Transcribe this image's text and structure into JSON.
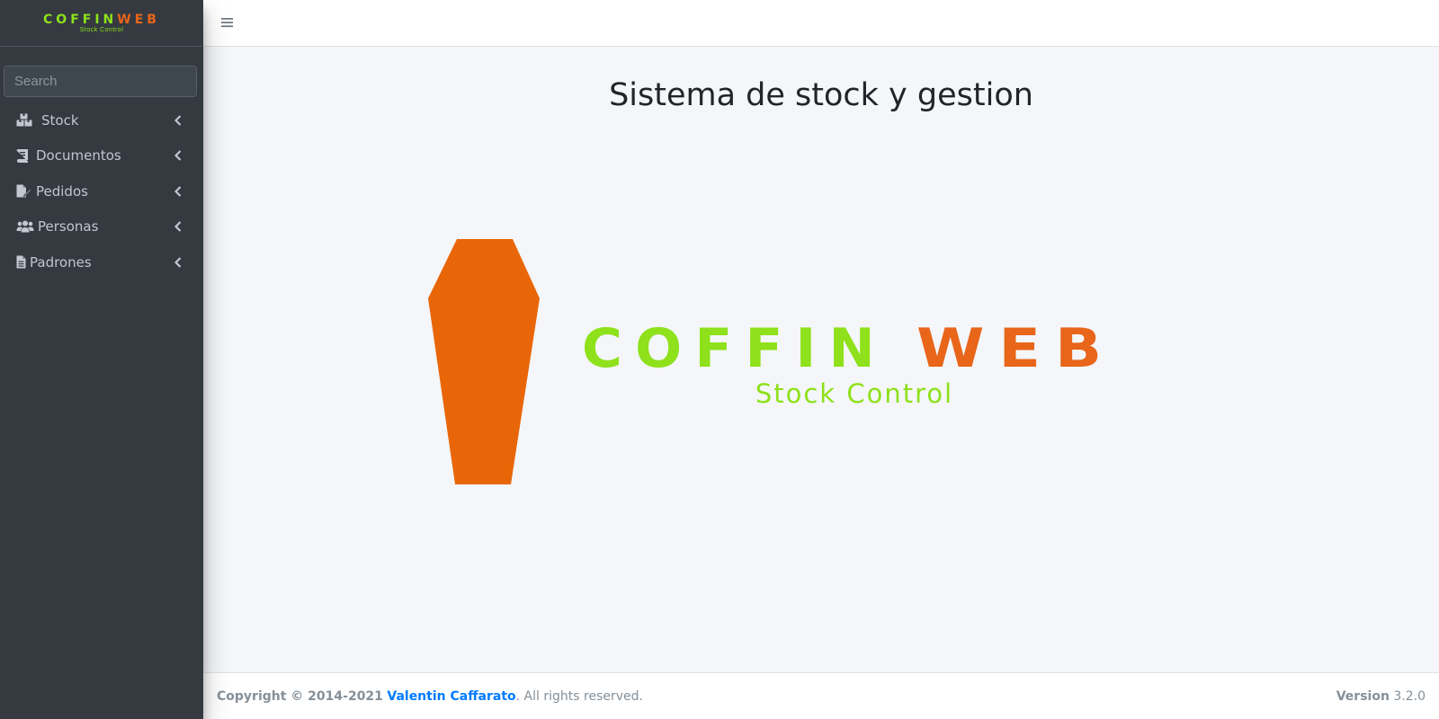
{
  "brand": {
    "name_part1": "COFFIN",
    "name_part2": "WEB",
    "subtitle": "Stock Control"
  },
  "search": {
    "placeholder": "Search",
    "value": ""
  },
  "sidebar": {
    "items": [
      {
        "label": "Stock",
        "icon": "boxes-icon"
      },
      {
        "label": "Documentos",
        "icon": "book-icon"
      },
      {
        "label": "Pedidos",
        "icon": "file-signature-icon"
      },
      {
        "label": "Personas",
        "icon": "users-icon"
      },
      {
        "label": "Padrones",
        "icon": "file-alt-icon"
      }
    ]
  },
  "main": {
    "title": "Sistema de stock y gestion",
    "logo": {
      "name_part1": "COFFIN",
      "name_part2": "WEB",
      "subtitle": "Stock Control"
    }
  },
  "footer": {
    "copyright_prefix": "Copyright © 2014-2021",
    "author": "Valentin Caffarato",
    "suffix": ". All rights reserved.",
    "version_label": "Version",
    "version_value": "3.2.0"
  },
  "colors": {
    "sidebar_bg": "#343a40",
    "brand_green": "#8ee11b",
    "brand_orange": "#e8651a",
    "link": "#007bff"
  }
}
